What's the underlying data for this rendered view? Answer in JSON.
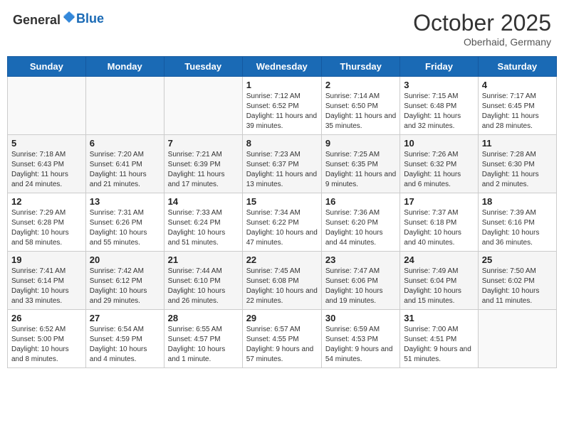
{
  "header": {
    "logo_general": "General",
    "logo_blue": "Blue",
    "title": "October 2025",
    "subtitle": "Oberhaid, Germany"
  },
  "days_of_week": [
    "Sunday",
    "Monday",
    "Tuesday",
    "Wednesday",
    "Thursday",
    "Friday",
    "Saturday"
  ],
  "weeks": [
    [
      {
        "day": "",
        "info": ""
      },
      {
        "day": "",
        "info": ""
      },
      {
        "day": "",
        "info": ""
      },
      {
        "day": "1",
        "info": "Sunrise: 7:12 AM\nSunset: 6:52 PM\nDaylight: 11 hours and 39 minutes."
      },
      {
        "day": "2",
        "info": "Sunrise: 7:14 AM\nSunset: 6:50 PM\nDaylight: 11 hours and 35 minutes."
      },
      {
        "day": "3",
        "info": "Sunrise: 7:15 AM\nSunset: 6:48 PM\nDaylight: 11 hours and 32 minutes."
      },
      {
        "day": "4",
        "info": "Sunrise: 7:17 AM\nSunset: 6:45 PM\nDaylight: 11 hours and 28 minutes."
      }
    ],
    [
      {
        "day": "5",
        "info": "Sunrise: 7:18 AM\nSunset: 6:43 PM\nDaylight: 11 hours and 24 minutes."
      },
      {
        "day": "6",
        "info": "Sunrise: 7:20 AM\nSunset: 6:41 PM\nDaylight: 11 hours and 21 minutes."
      },
      {
        "day": "7",
        "info": "Sunrise: 7:21 AM\nSunset: 6:39 PM\nDaylight: 11 hours and 17 minutes."
      },
      {
        "day": "8",
        "info": "Sunrise: 7:23 AM\nSunset: 6:37 PM\nDaylight: 11 hours and 13 minutes."
      },
      {
        "day": "9",
        "info": "Sunrise: 7:25 AM\nSunset: 6:35 PM\nDaylight: 11 hours and 9 minutes."
      },
      {
        "day": "10",
        "info": "Sunrise: 7:26 AM\nSunset: 6:32 PM\nDaylight: 11 hours and 6 minutes."
      },
      {
        "day": "11",
        "info": "Sunrise: 7:28 AM\nSunset: 6:30 PM\nDaylight: 11 hours and 2 minutes."
      }
    ],
    [
      {
        "day": "12",
        "info": "Sunrise: 7:29 AM\nSunset: 6:28 PM\nDaylight: 10 hours and 58 minutes."
      },
      {
        "day": "13",
        "info": "Sunrise: 7:31 AM\nSunset: 6:26 PM\nDaylight: 10 hours and 55 minutes."
      },
      {
        "day": "14",
        "info": "Sunrise: 7:33 AM\nSunset: 6:24 PM\nDaylight: 10 hours and 51 minutes."
      },
      {
        "day": "15",
        "info": "Sunrise: 7:34 AM\nSunset: 6:22 PM\nDaylight: 10 hours and 47 minutes."
      },
      {
        "day": "16",
        "info": "Sunrise: 7:36 AM\nSunset: 6:20 PM\nDaylight: 10 hours and 44 minutes."
      },
      {
        "day": "17",
        "info": "Sunrise: 7:37 AM\nSunset: 6:18 PM\nDaylight: 10 hours and 40 minutes."
      },
      {
        "day": "18",
        "info": "Sunrise: 7:39 AM\nSunset: 6:16 PM\nDaylight: 10 hours and 36 minutes."
      }
    ],
    [
      {
        "day": "19",
        "info": "Sunrise: 7:41 AM\nSunset: 6:14 PM\nDaylight: 10 hours and 33 minutes."
      },
      {
        "day": "20",
        "info": "Sunrise: 7:42 AM\nSunset: 6:12 PM\nDaylight: 10 hours and 29 minutes."
      },
      {
        "day": "21",
        "info": "Sunrise: 7:44 AM\nSunset: 6:10 PM\nDaylight: 10 hours and 26 minutes."
      },
      {
        "day": "22",
        "info": "Sunrise: 7:45 AM\nSunset: 6:08 PM\nDaylight: 10 hours and 22 minutes."
      },
      {
        "day": "23",
        "info": "Sunrise: 7:47 AM\nSunset: 6:06 PM\nDaylight: 10 hours and 19 minutes."
      },
      {
        "day": "24",
        "info": "Sunrise: 7:49 AM\nSunset: 6:04 PM\nDaylight: 10 hours and 15 minutes."
      },
      {
        "day": "25",
        "info": "Sunrise: 7:50 AM\nSunset: 6:02 PM\nDaylight: 10 hours and 11 minutes."
      }
    ],
    [
      {
        "day": "26",
        "info": "Sunrise: 6:52 AM\nSunset: 5:00 PM\nDaylight: 10 hours and 8 minutes."
      },
      {
        "day": "27",
        "info": "Sunrise: 6:54 AM\nSunset: 4:59 PM\nDaylight: 10 hours and 4 minutes."
      },
      {
        "day": "28",
        "info": "Sunrise: 6:55 AM\nSunset: 4:57 PM\nDaylight: 10 hours and 1 minute."
      },
      {
        "day": "29",
        "info": "Sunrise: 6:57 AM\nSunset: 4:55 PM\nDaylight: 9 hours and 57 minutes."
      },
      {
        "day": "30",
        "info": "Sunrise: 6:59 AM\nSunset: 4:53 PM\nDaylight: 9 hours and 54 minutes."
      },
      {
        "day": "31",
        "info": "Sunrise: 7:00 AM\nSunset: 4:51 PM\nDaylight: 9 hours and 51 minutes."
      },
      {
        "day": "",
        "info": ""
      }
    ]
  ]
}
